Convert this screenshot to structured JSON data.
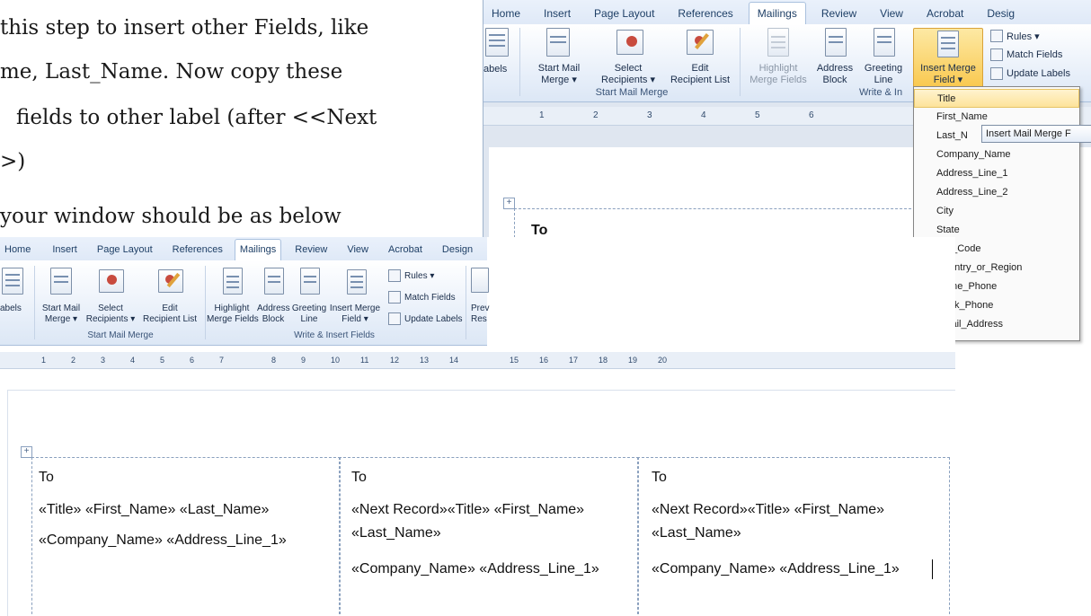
{
  "instructions": {
    "line1": "this step to insert other Fields, like",
    "line2": "me, Last_Name. Now copy these",
    "line3": "fields to other label (after <<Next",
    "line4": ">)",
    "line5": "your window should be as below"
  },
  "top_window": {
    "tabs": [
      "Home",
      "Insert",
      "Page Layout",
      "References",
      "Mailings",
      "Review",
      "View",
      "Acrobat",
      "Desig"
    ],
    "active_tab": "Mailings",
    "buttons": {
      "labels": "abels",
      "start_mail_merge": [
        "Start Mail",
        "Merge ▾"
      ],
      "select_recipients": [
        "Select",
        "Recipients ▾"
      ],
      "edit_recipient_list": [
        "Edit",
        "Recipient List"
      ],
      "highlight_merge_fields": [
        "Highlight",
        "Merge Fields"
      ],
      "address_block": [
        "Address",
        "Block"
      ],
      "greeting_line": [
        "Greeting",
        "Line"
      ],
      "insert_merge_field": [
        "Insert Merge",
        "Field ▾"
      ],
      "rules": "Rules ▾",
      "match_fields": "Match Fields",
      "update_labels": "Update Labels"
    },
    "groups": {
      "start_mail_merge": "Start Mail Merge",
      "write_insert": "Write & In"
    },
    "ruler_numbers": [
      "1",
      "2",
      "3",
      "4",
      "5",
      "6"
    ],
    "cell_text": "To",
    "dropdown_items": [
      "Title",
      "First_Name",
      "Last_N",
      "Company_Name",
      "Address_Line_1",
      "Address_Line_2",
      "City",
      "State",
      "ZIP_Code",
      "Country_or_Region",
      "Home_Phone",
      "Work_Phone",
      "Email_Address"
    ],
    "selected_item": "Title",
    "tooltip": "Insert Mail Merge F"
  },
  "bottom_window": {
    "tabs": [
      "Home",
      "Insert",
      "Page Layout",
      "References",
      "Mailings",
      "Review",
      "View",
      "Acrobat",
      "Design"
    ],
    "active_tab": "Mailings",
    "buttons": {
      "labels": "abels",
      "start_mail_merge": [
        "Start Mail",
        "Merge ▾"
      ],
      "select_recipients": [
        "Select",
        "Recipients ▾"
      ],
      "edit_recipient_list": [
        "Edit",
        "Recipient List"
      ],
      "highlight_merge_fields": [
        "Highlight",
        "Merge Fields"
      ],
      "address_block": [
        "Address",
        "Block"
      ],
      "greeting_line": [
        "Greeting",
        "Line"
      ],
      "insert_merge_field": [
        "Insert Merge",
        "Field ▾"
      ],
      "rules": "Rules ▾",
      "match_fields": "Match Fields",
      "update_labels": "Update Labels",
      "preview": [
        "Prev",
        "Res"
      ]
    },
    "groups": {
      "start_mail_merge": "Start Mail Merge",
      "write_insert": "Write & Insert Fields"
    },
    "ruler_numbers": [
      "1",
      "2",
      "3",
      "4",
      "5",
      "6",
      "7",
      "8",
      "9",
      "10",
      "11",
      "12",
      "13",
      "14",
      "15",
      "16",
      "17",
      "18",
      "19",
      "20"
    ],
    "labels": [
      {
        "to": "To",
        "line1": "«Title» «First_Name» «Last_Name»",
        "line2": "«Company_Name» «Address_Line_1»",
        "line3": ""
      },
      {
        "to": "To",
        "line1": "«Next Record»«Title» «First_Name»",
        "line2": "«Last_Name»",
        "line3": "«Company_Name» «Address_Line_1»"
      },
      {
        "to": "To",
        "line1": "«Next Record»«Title» «First_Name»",
        "line2": "«Last_Name»",
        "line3": "«Company_Name» «Address_Line_1»"
      }
    ]
  }
}
